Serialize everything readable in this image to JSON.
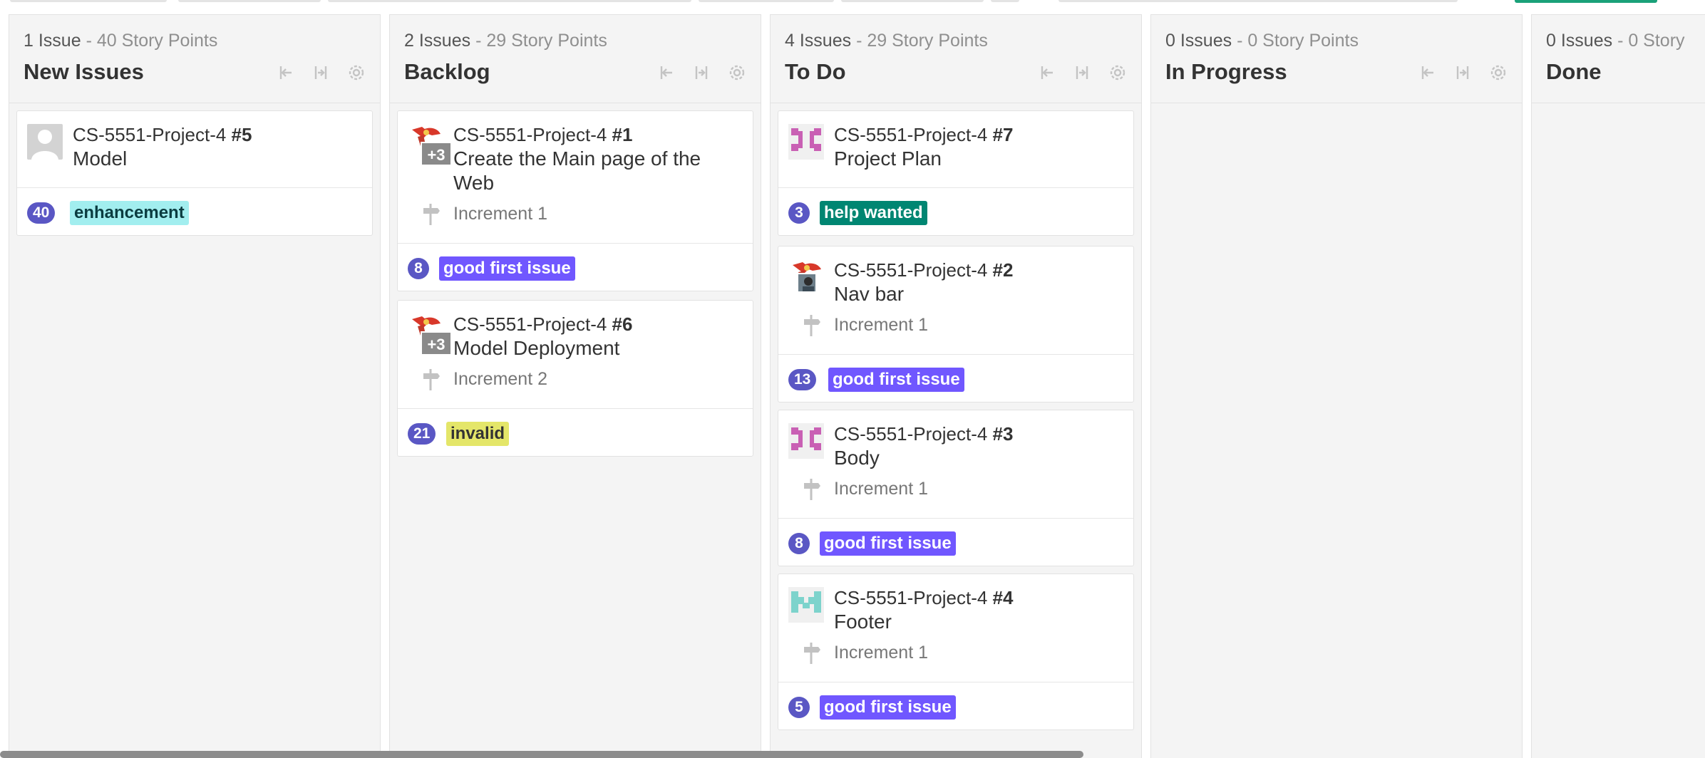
{
  "colors": {
    "points_badge": "#5a57c4",
    "label_enhancement": "#a2eeef",
    "label_help_wanted": "#008672",
    "label_good_first_issue": "#7057ff",
    "label_invalid": "#e4e669",
    "column_bg": "#f4f4f4"
  },
  "columns": [
    {
      "count": "1 Issue",
      "points": "- 40 Story Points",
      "title": "New Issues"
    },
    {
      "count": "2 Issues",
      "points": "- 29 Story Points",
      "title": "Backlog"
    },
    {
      "count": "4 Issues",
      "points": "- 29 Story Points",
      "title": "To Do"
    },
    {
      "count": "0 Issues",
      "points": "- 0 Story Points",
      "title": "In Progress"
    },
    {
      "count": "0 Issues",
      "points": "- 0 Story",
      "title": "Done"
    }
  ],
  "column_tools": [
    "collapse-left-icon",
    "collapse-column-icon",
    "gear-icon"
  ],
  "cards": {
    "c5": {
      "repo": "CS-5551-Project-4",
      "num": "#5",
      "title": "Model",
      "points": "40",
      "label": "enhancement"
    },
    "c1": {
      "repo": "CS-5551-Project-4",
      "num": "#1",
      "title": "Create the Main page of the Web",
      "milestone": "Increment 1",
      "extra_assignees": "+3",
      "points": "8",
      "label": "good first issue"
    },
    "c6": {
      "repo": "CS-5551-Project-4",
      "num": "#6",
      "title": "Model Deployment",
      "milestone": "Increment 2",
      "extra_assignees": "+3",
      "points": "21",
      "label": "invalid"
    },
    "c7": {
      "repo": "CS-5551-Project-4",
      "num": "#7",
      "title": "Project Plan",
      "points": "3",
      "label": "help wanted"
    },
    "c2": {
      "repo": "CS-5551-Project-4",
      "num": "#2",
      "title": "Nav bar",
      "milestone": "Increment 1",
      "points": "13",
      "label": "good first issue"
    },
    "c3": {
      "repo": "CS-5551-Project-4",
      "num": "#3",
      "title": "Body",
      "milestone": "Increment 1",
      "points": "8",
      "label": "good first issue"
    },
    "c4": {
      "repo": "CS-5551-Project-4",
      "num": "#4",
      "title": "Footer",
      "milestone": "Increment 1",
      "points": "5",
      "label": "good first issue"
    }
  }
}
